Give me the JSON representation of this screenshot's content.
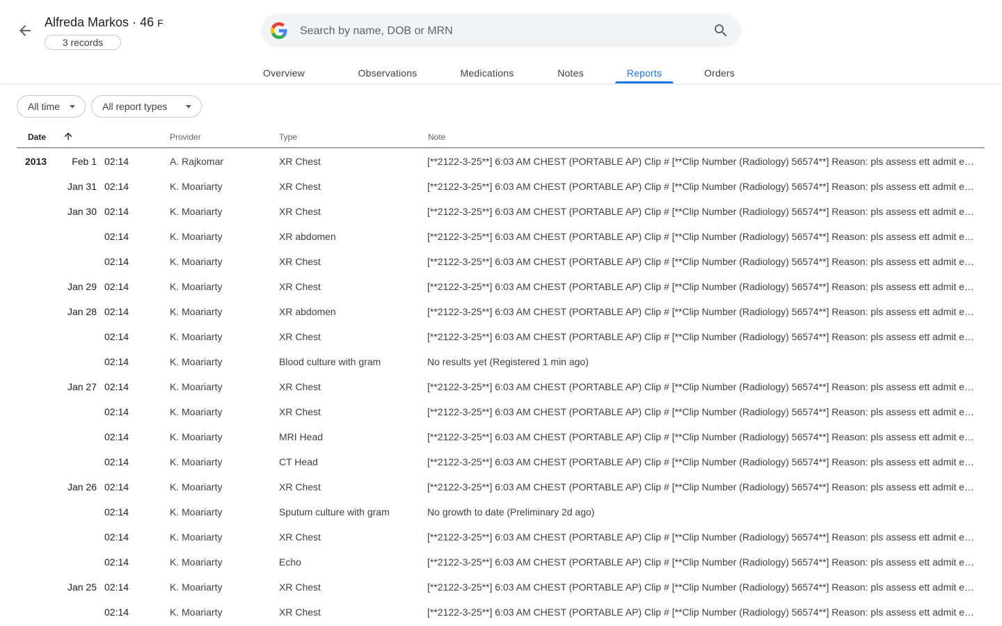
{
  "patient": {
    "name": "Alfreda Markos",
    "age": "46",
    "sex": "F",
    "records": "3 records"
  },
  "search": {
    "placeholder": "Search by name, DOB or MRN"
  },
  "tabs": [
    {
      "label": "Overview"
    },
    {
      "label": "Observations"
    },
    {
      "label": "Medications"
    },
    {
      "label": "Notes"
    },
    {
      "label": "Reports",
      "active": true
    },
    {
      "label": "Orders"
    }
  ],
  "filters": {
    "time": "All time",
    "type": "All report types"
  },
  "columns": {
    "date": "Date",
    "provider": "Provider",
    "type": "Type",
    "note": "Note"
  },
  "colors": {
    "accent": "#1a73e8"
  },
  "rows": [
    {
      "year": "2013",
      "day": "Feb 1",
      "time": "02:14",
      "provider": "A. Rajkomar",
      "type": "XR Chest",
      "note": "[**2122-3-25**] 6:03 AM CHEST (PORTABLE AP) Clip # [**Clip Number (Radiology) 56574**] Reason: pls assess ett admit ett placement"
    },
    {
      "year": "",
      "day": "Jan 31",
      "time": "02:14",
      "provider": "K. Moariarty",
      "type": "XR Chest",
      "note": "[**2122-3-25**] 6:03 AM CHEST (PORTABLE AP) Clip # [**Clip Number (Radiology) 56574**] Reason: pls assess ett admit ett placement"
    },
    {
      "year": "",
      "day": "Jan 30",
      "time": "02:14",
      "provider": "K. Moariarty",
      "type": "XR Chest",
      "note": "[**2122-3-25**] 6:03 AM CHEST (PORTABLE AP) Clip # [**Clip Number (Radiology) 56574**] Reason: pls assess ett admit ett placement"
    },
    {
      "year": "",
      "day": "",
      "time": "02:14",
      "provider": "K. Moariarty",
      "type": "XR abdomen",
      "note": "[**2122-3-25**] 6:03 AM CHEST (PORTABLE AP) Clip # [**Clip Number (Radiology) 56574**] Reason: pls assess ett admit ett placement"
    },
    {
      "year": "",
      "day": "",
      "time": "02:14",
      "provider": "K. Moariarty",
      "type": "XR Chest",
      "note": "[**2122-3-25**] 6:03 AM CHEST (PORTABLE AP) Clip # [**Clip Number (Radiology) 56574**] Reason: pls assess ett admit ett placement"
    },
    {
      "year": "",
      "day": "Jan 29",
      "time": "02:14",
      "provider": "K. Moariarty",
      "type": "XR Chest",
      "note": "[**2122-3-25**] 6:03 AM CHEST (PORTABLE AP) Clip # [**Clip Number (Radiology) 56574**] Reason: pls assess ett admit ett placement"
    },
    {
      "year": "",
      "day": "Jan 28",
      "time": "02:14",
      "provider": "K. Moariarty",
      "type": "XR abdomen",
      "note": "[**2122-3-25**] 6:03 AM CHEST (PORTABLE AP) Clip # [**Clip Number (Radiology) 56574**] Reason: pls assess ett admit ett placement"
    },
    {
      "year": "",
      "day": "",
      "time": "02:14",
      "provider": "K. Moariarty",
      "type": "XR Chest",
      "note": "[**2122-3-25**] 6:03 AM CHEST (PORTABLE AP) Clip # [**Clip Number (Radiology) 56574**] Reason: pls assess ett admit ett placement"
    },
    {
      "year": "",
      "day": "",
      "time": "02:14",
      "provider": "K. Moariarty",
      "type": "Blood culture with gram",
      "note": "No results yet (Registered 1 min ago)"
    },
    {
      "year": "",
      "day": "Jan 27",
      "time": "02:14",
      "provider": "K. Moariarty",
      "type": "XR Chest",
      "note": "[**2122-3-25**] 6:03 AM CHEST (PORTABLE AP) Clip # [**Clip Number (Radiology) 56574**] Reason: pls assess ett admit ett placement"
    },
    {
      "year": "",
      "day": "",
      "time": "02:14",
      "provider": "K. Moariarty",
      "type": "XR Chest",
      "note": "[**2122-3-25**] 6:03 AM CHEST (PORTABLE AP) Clip # [**Clip Number (Radiology) 56574**] Reason: pls assess ett admit ett placement"
    },
    {
      "year": "",
      "day": "",
      "time": "02:14",
      "provider": "K. Moariarty",
      "type": "MRI Head",
      "note": "[**2122-3-25**] 6:03 AM CHEST (PORTABLE AP) Clip # [**Clip Number (Radiology) 56574**] Reason: pls assess ett admit ett placement"
    },
    {
      "year": "",
      "day": "",
      "time": "02:14",
      "provider": "K. Moariarty",
      "type": "CT Head",
      "note": "[**2122-3-25**] 6:03 AM CHEST (PORTABLE AP) Clip # [**Clip Number (Radiology) 56574**] Reason: pls assess ett admit ett placement"
    },
    {
      "year": "",
      "day": "Jan 26",
      "time": "02:14",
      "provider": "K. Moariarty",
      "type": "XR Chest",
      "note": "[**2122-3-25**] 6:03 AM CHEST (PORTABLE AP) Clip # [**Clip Number (Radiology) 56574**] Reason: pls assess ett admit ett placement"
    },
    {
      "year": "",
      "day": "",
      "time": "02:14",
      "provider": "K. Moariarty",
      "type": "Sputum culture with gram",
      "note": "No growth to date (Preliminary 2d ago)"
    },
    {
      "year": "",
      "day": "",
      "time": "02:14",
      "provider": "K. Moariarty",
      "type": "XR Chest",
      "note": "[**2122-3-25**] 6:03 AM CHEST (PORTABLE AP) Clip # [**Clip Number (Radiology) 56574**] Reason: pls assess ett admit ett placement"
    },
    {
      "year": "",
      "day": "",
      "time": "02:14",
      "provider": "K. Moariarty",
      "type": "Echo",
      "note": "[**2122-3-25**] 6:03 AM CHEST (PORTABLE AP) Clip # [**Clip Number (Radiology) 56574**] Reason: pls assess ett admit ett placement"
    },
    {
      "year": "",
      "day": "Jan 25",
      "time": "02:14",
      "provider": "K. Moariarty",
      "type": "XR Chest",
      "note": "[**2122-3-25**] 6:03 AM CHEST (PORTABLE AP) Clip # [**Clip Number (Radiology) 56574**] Reason: pls assess ett admit ett placement"
    },
    {
      "year": "",
      "day": "",
      "time": "02:14",
      "provider": "K. Moariarty",
      "type": "XR Chest",
      "note": "[**2122-3-25**] 6:03 AM CHEST (PORTABLE AP) Clip # [**Clip Number (Radiology) 56574**] Reason: pls assess ett admit ett placement"
    }
  ]
}
